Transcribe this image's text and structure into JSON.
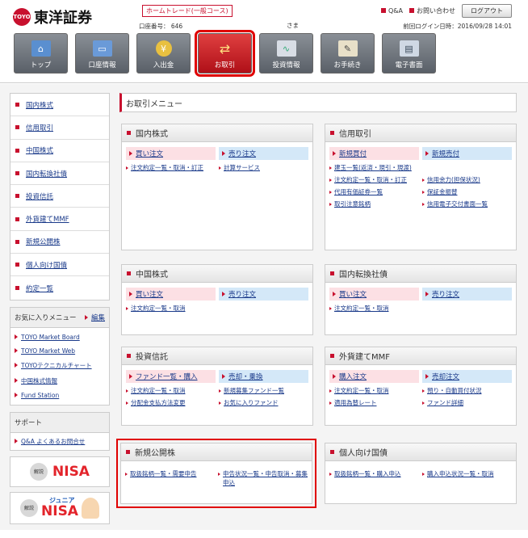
{
  "header": {
    "logo_text": "東洋証券",
    "logo_mark": "TOYO",
    "course": "ホームトレード(一般コース)",
    "account": "口座番号： 646",
    "sama": "さま",
    "qa": "Q&A",
    "contact": "お問い合わせ",
    "logout": "ログアウト",
    "last_login": "前回ログイン日時：2016/09/28 14:01"
  },
  "gnav": [
    {
      "label": "トップ",
      "icon": "home-icon"
    },
    {
      "label": "口座情報",
      "icon": "card-icon"
    },
    {
      "label": "入出金",
      "icon": "coin-icon"
    },
    {
      "label": "お取引",
      "icon": "exchange-icon"
    },
    {
      "label": "投資情報",
      "icon": "chart-icon"
    },
    {
      "label": "お手続き",
      "icon": "pen-icon"
    },
    {
      "label": "電子書面",
      "icon": "monitor-icon"
    }
  ],
  "sidebar": {
    "items": [
      "国内株式",
      "信用取引",
      "中国株式",
      "国内転換社債",
      "投資信託",
      "外貨建てMMF",
      "新規公開株",
      "個人向け国債",
      "約定一覧"
    ]
  },
  "favorites": {
    "title": "お気に入りメニュー",
    "edit": "編集",
    "items": [
      "TOYO Market Board",
      "TOYO Market Web",
      "TOYOテクニカルチャート",
      "中国株式情報",
      "Fund Station"
    ]
  },
  "support": {
    "title": "サポート",
    "items": [
      "Q&A よくあるお問合せ"
    ]
  },
  "banners": {
    "nisa_label": "NISA",
    "badge": "解説",
    "junior": "ジュニア"
  },
  "page_title": "お取引メニュー",
  "panels": {
    "domestic": {
      "title": "国内株式",
      "buy": "買い注文",
      "sell": "売り注文",
      "links": [
        [
          "注文約定一覧・取消・訂正",
          "計算サービス"
        ]
      ]
    },
    "margin": {
      "title": "信用取引",
      "buy": "新規買付",
      "sell": "新規売付",
      "links": [
        [
          "建玉一覧(返済・現引・現渡)",
          ""
        ],
        [
          "注文約定一覧・取消・訂正",
          "信用余力(担保状況)"
        ],
        [
          "代用有価証券一覧",
          "保証金振替"
        ],
        [
          "取引注意銘柄",
          "信用電子交付書面一覧"
        ]
      ]
    },
    "china": {
      "title": "中国株式",
      "buy": "買い注文",
      "sell": "売り注文",
      "links": [
        [
          "注文約定一覧・取消",
          ""
        ]
      ]
    },
    "cb": {
      "title": "国内転換社債",
      "buy": "買い注文",
      "sell": "売り注文",
      "links": [
        [
          "注文約定一覧・取消",
          ""
        ]
      ]
    },
    "fund": {
      "title": "投資信託",
      "buy": "ファンド一覧・購入",
      "sell": "売却・乗換",
      "links": [
        [
          "注文約定一覧・取消",
          "新規募集ファンド一覧"
        ],
        [
          "分配金支払方法変更",
          "お気に入りファンド"
        ]
      ]
    },
    "mmf": {
      "title": "外貨建てMMF",
      "buy": "購入注文",
      "sell": "売却注文",
      "links": [
        [
          "注文約定一覧・取消",
          "預り・自動買付状況"
        ],
        [
          "適用為替レート",
          "ファンド詳細"
        ]
      ]
    },
    "ipo": {
      "title": "新規公開株",
      "links": [
        [
          "取扱銘柄一覧・需要申告",
          "申告状況一覧・申告取消・募集申込"
        ]
      ]
    },
    "jgb": {
      "title": "個人向け国債",
      "links": [
        [
          "取扱銘柄一覧・購入申込",
          "購入申込状況一覧・取消"
        ]
      ]
    }
  }
}
